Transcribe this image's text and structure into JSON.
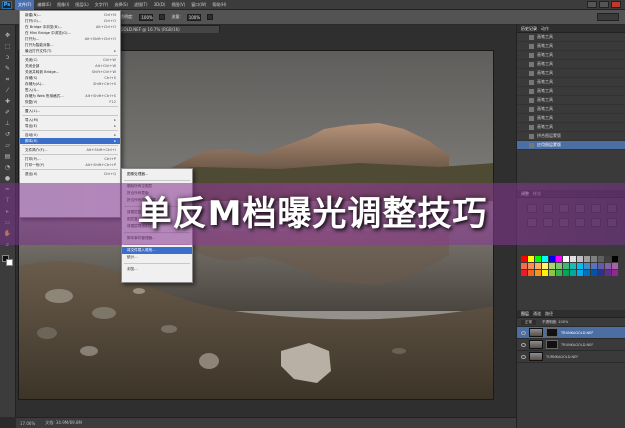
{
  "app": {
    "logo_text": "Ps"
  },
  "menubar": {
    "items": [
      {
        "label": "文件(F)",
        "active": true
      },
      {
        "label": "编辑(E)"
      },
      {
        "label": "图像(I)"
      },
      {
        "label": "图层(L)"
      },
      {
        "label": "文字(Y)"
      },
      {
        "label": "选择(S)"
      },
      {
        "label": "滤镜(T)"
      },
      {
        "label": "3D(D)"
      },
      {
        "label": "视图(V)"
      },
      {
        "label": "窗口(W)"
      },
      {
        "label": "帮助(H)"
      }
    ]
  },
  "options_bar": {
    "opacity_label": "不透明度:",
    "opacity_value": "100%",
    "flow_label": "流量:",
    "flow_value": "100%"
  },
  "document": {
    "tab_title": "TRUNKAGOLD.NEF @ 16.7% (RGB/16)",
    "zoom": "17.06%",
    "doc_size": "文档: 34.9M/69.8M"
  },
  "file_menu": {
    "items": [
      {
        "label": "新建(N)...",
        "shortcut": "Ctrl+N"
      },
      {
        "label": "打开(O)...",
        "shortcut": "Ctrl+O"
      },
      {
        "label": "在 Bridge 中浏览(B)...",
        "shortcut": "Alt+Ctrl+O"
      },
      {
        "label": "在 Mini Bridge 中浏览(G)...",
        "shortcut": ""
      },
      {
        "label": "打开为...",
        "shortcut": "Alt+Shift+Ctrl+O"
      },
      {
        "label": "打开为智能对象...",
        "shortcut": ""
      },
      {
        "label": "最近打开文件(T)",
        "shortcut": "▸"
      },
      {
        "sep": true
      },
      {
        "label": "关闭(C)",
        "shortcut": "Ctrl+W"
      },
      {
        "label": "关闭全部",
        "shortcut": "Alt+Ctrl+W"
      },
      {
        "label": "关闭并转到 Bridge...",
        "shortcut": "Shift+Ctrl+W"
      },
      {
        "label": "存储(S)",
        "shortcut": "Ctrl+S"
      },
      {
        "label": "存储为(A)...",
        "shortcut": "Shift+Ctrl+S"
      },
      {
        "label": "签入(I)...",
        "shortcut": ""
      },
      {
        "label": "存储为 Web 所用格式...",
        "shortcut": "Alt+Shift+Ctrl+S"
      },
      {
        "label": "恢复(V)",
        "shortcut": "F12"
      },
      {
        "sep": true
      },
      {
        "label": "置入(L)...",
        "shortcut": ""
      },
      {
        "sep": true
      },
      {
        "label": "导入(M)",
        "shortcut": "▸"
      },
      {
        "label": "导出(E)",
        "shortcut": "▸"
      },
      {
        "sep": true
      },
      {
        "label": "自动(U)",
        "shortcut": "▸"
      },
      {
        "label": "脚本(R)",
        "shortcut": "▸",
        "hl": true
      },
      {
        "sep": true
      },
      {
        "label": "文件简介(F)...",
        "shortcut": "Alt+Shift+Ctrl+I"
      },
      {
        "sep": true
      },
      {
        "label": "打印(P)...",
        "shortcut": "Ctrl+P"
      },
      {
        "label": "打印一份(Y)",
        "shortcut": "Alt+Shift+Ctrl+P"
      },
      {
        "sep": true
      },
      {
        "label": "退出(X)",
        "shortcut": "Ctrl+Q"
      }
    ]
  },
  "script_submenu": {
    "items": [
      {
        "label": "图像处理器..."
      },
      {
        "sep": true
      },
      {
        "label": "删除所有空图层"
      },
      {
        "label": "拼合所有蒙版"
      },
      {
        "label": "拼合所有图层效果"
      },
      {
        "sep": true
      },
      {
        "label": "将图层复合导出到 PDF..."
      },
      {
        "label": "图层复合导出到文件..."
      },
      {
        "label": "将图层导出到文件..."
      },
      {
        "sep": true
      },
      {
        "label": "脚本事件管理器..."
      },
      {
        "sep": true
      },
      {
        "label": "将文件载入堆栈...",
        "hl": true
      },
      {
        "label": "统计..."
      },
      {
        "sep": true
      },
      {
        "label": "浏览..."
      }
    ]
  },
  "history_panel": {
    "tabs": [
      "历史记录",
      "动作"
    ],
    "rows": [
      {
        "label": "画笔工具"
      },
      {
        "label": "画笔工具"
      },
      {
        "label": "画笔工具"
      },
      {
        "label": "画笔工具"
      },
      {
        "label": "画笔工具"
      },
      {
        "label": "画笔工具"
      },
      {
        "label": "画笔工具"
      },
      {
        "label": "画笔工具"
      },
      {
        "label": "画笔工具"
      },
      {
        "label": "画笔工具"
      },
      {
        "label": "画笔工具"
      },
      {
        "label": "拼合图层蒙版"
      },
      {
        "label": "应用图层蒙版",
        "selected": true
      }
    ]
  },
  "adjustments_panel": {
    "tabs": [
      "调整",
      "样式"
    ]
  },
  "swatches_panel": {
    "colors": [
      "#ff0000",
      "#ffff00",
      "#00ff00",
      "#00ffff",
      "#0000ff",
      "#ff00ff",
      "#ffffff",
      "#e0e0e0",
      "#c0c0c0",
      "#a0a0a0",
      "#808080",
      "#606060",
      "#404040",
      "#000000",
      "#f26c4f",
      "#f68e56",
      "#fbaf5c",
      "#fff467",
      "#acd372",
      "#7cc576",
      "#3bb878",
      "#1abbb4",
      "#00bff3",
      "#438ccb",
      "#5574b9",
      "#605ca9",
      "#855fa8",
      "#a763a9",
      "#ed1c24",
      "#f26522",
      "#f7941d",
      "#fff200",
      "#8dc63f",
      "#39b54a",
      "#00a651",
      "#00a99d",
      "#00aeef",
      "#0072bc",
      "#0054a6",
      "#2e3192",
      "#662d91",
      "#92278f"
    ]
  },
  "layers_panel": {
    "tabs": [
      "图层",
      "通道",
      "路径"
    ],
    "blend_mode": "正常",
    "opacity": "不透明度: 100%",
    "layers": [
      {
        "name": "TRUNKAGOLD.NEF",
        "selected": true,
        "mask": true
      },
      {
        "name": "TRUNKAGOLD.NEF",
        "mask": true
      },
      {
        "name": "TURNKAGOLD.NEF"
      }
    ]
  },
  "overlay": {
    "title": "单反M档曝光调整技巧"
  }
}
